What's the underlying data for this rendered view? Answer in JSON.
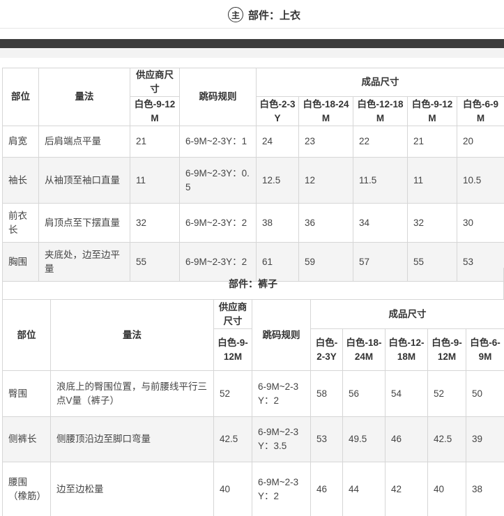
{
  "section_top": {
    "badge": "主",
    "title": "部件：上衣",
    "headers": {
      "part": "部位",
      "method": "量法",
      "supplier_size": "供应商尺寸",
      "grading_rule": "跳码规则",
      "finished_size": "成品尺寸",
      "supplier_col": "白色-9-12M",
      "size_cols": [
        "白色-2-3Y",
        "白色-18-24M",
        "白色-12-18M",
        "白色-9-12M",
        "白色-6-9M"
      ]
    },
    "rows": [
      {
        "part": "肩宽",
        "method": "后肩端点平量",
        "supplier": "21",
        "rule": "6-9M~2-3Y：1",
        "sizes": [
          "24",
          "23",
          "22",
          "21",
          "20"
        ]
      },
      {
        "part": "袖长",
        "method": "从袖顶至袖口直量",
        "supplier": "11",
        "rule": "6-9M~2-3Y：0.5",
        "sizes": [
          "12.5",
          "12",
          "11.5",
          "11",
          "10.5"
        ]
      },
      {
        "part": "前衣长",
        "method": "肩顶点至下摆直量",
        "supplier": "32",
        "rule": "6-9M~2-3Y：2",
        "sizes": [
          "38",
          "36",
          "34",
          "32",
          "30"
        ]
      },
      {
        "part": "胸围",
        "method": "夹底处，边至边平量",
        "supplier": "55",
        "rule": "6-9M~2-3Y：2",
        "sizes": [
          "61",
          "59",
          "57",
          "55",
          "53"
        ]
      }
    ]
  },
  "section_bottom": {
    "title": "部件：裤子",
    "headers": {
      "part": "部位",
      "method": "量法",
      "supplier_size": "供应商尺寸",
      "grading_rule": "跳码规则",
      "finished_size": "成品尺寸",
      "supplier_col": "白色-9-12M",
      "size_cols": [
        "白色-2-3Y",
        "白色-18-24M",
        "白色-12-18M",
        "白色-9-12M",
        "白色-6-9M"
      ]
    },
    "rows": [
      {
        "part": "臀围",
        "method": "浪底上的臀围位置，与前腰线平行三点V量（裤子）",
        "supplier": "52",
        "rule": "6-9M~2-3Y：2",
        "sizes": [
          "58",
          "56",
          "54",
          "52",
          "50"
        ]
      },
      {
        "part": "侧裤长",
        "method": "侧腰顶沿边至脚口弯量",
        "supplier": "42.5",
        "rule": "6-9M~2-3Y：3.5",
        "sizes": [
          "53",
          "49.5",
          "46",
          "42.5",
          "39"
        ]
      },
      {
        "part": "腰围（橡筋）",
        "method": "边至边松量",
        "supplier": "40",
        "rule": "6-9M~2-3Y：2",
        "sizes": [
          "46",
          "44",
          "42",
          "40",
          "38"
        ]
      }
    ]
  }
}
